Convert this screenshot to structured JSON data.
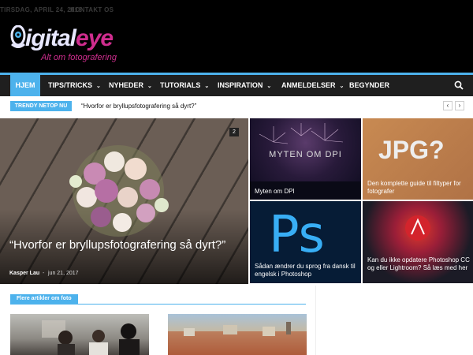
{
  "topbar": {
    "date": "TIRSDAG, APRIL 24, 2018",
    "contact": "KONTAKT OS"
  },
  "logo": {
    "brand_part1": "igital",
    "brand_part2": "eye",
    "tagline": "Alt om fotografering"
  },
  "nav": {
    "items": [
      {
        "label": "HJEM",
        "active": true,
        "dropdown": false
      },
      {
        "label": "TIPS/TRICKS",
        "dropdown": true
      },
      {
        "label": "NYHEDER",
        "dropdown": true
      },
      {
        "label": "TUTORIALS",
        "dropdown": true
      },
      {
        "label": "INSPIRATION",
        "dropdown": true
      },
      {
        "label": "ANMELDELSER",
        "dropdown": true
      },
      {
        "label": "BEGYNDER",
        "dropdown": false
      }
    ],
    "search_icon": "search-icon",
    "caret": "⌄"
  },
  "trending": {
    "badge": "TRENDY NETOP NU",
    "text": "“Hvorfor er bryllupsfotografering så dyrt?”",
    "prev": "‹",
    "next": "›"
  },
  "featured": {
    "count": "2",
    "title": "“Hvorfor er bryllupsfotografering så dyrt?”",
    "author": "Kasper Lau",
    "separator": "-",
    "date": "jun 21, 2017"
  },
  "tiles": [
    {
      "caption": "Myten om DPI",
      "overlay": "MYTEN OM DPI"
    },
    {
      "caption": "Den komplette guide til filtyper for fotografer",
      "overlay": "JPG?"
    },
    {
      "caption": "Sådan ændrer du sprog fra dansk til engelsk i Photoshop",
      "overlay": "Ps"
    },
    {
      "caption": "Kan du ikke opdatere Photoshop CC og eller Lightroom? Så læs med her",
      "overlay": "Adobe Creative Cloud"
    }
  ],
  "more": {
    "label": "Flere artikler om foto"
  },
  "colors": {
    "accent": "#4db2ec",
    "brand_pink": "#cf2d8e",
    "nav_bg": "#1f1f1f"
  }
}
